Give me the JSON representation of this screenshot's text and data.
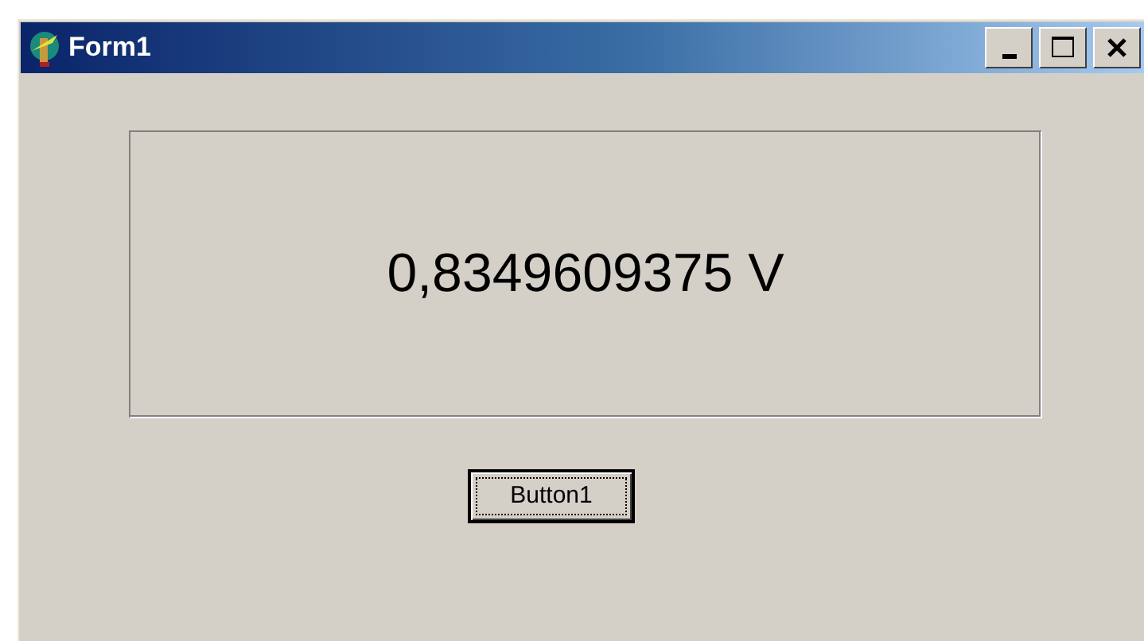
{
  "window": {
    "title": "Form1"
  },
  "panel": {
    "reading": "0,8349609375 V"
  },
  "button": {
    "label": "Button1",
    "focused": true
  }
}
